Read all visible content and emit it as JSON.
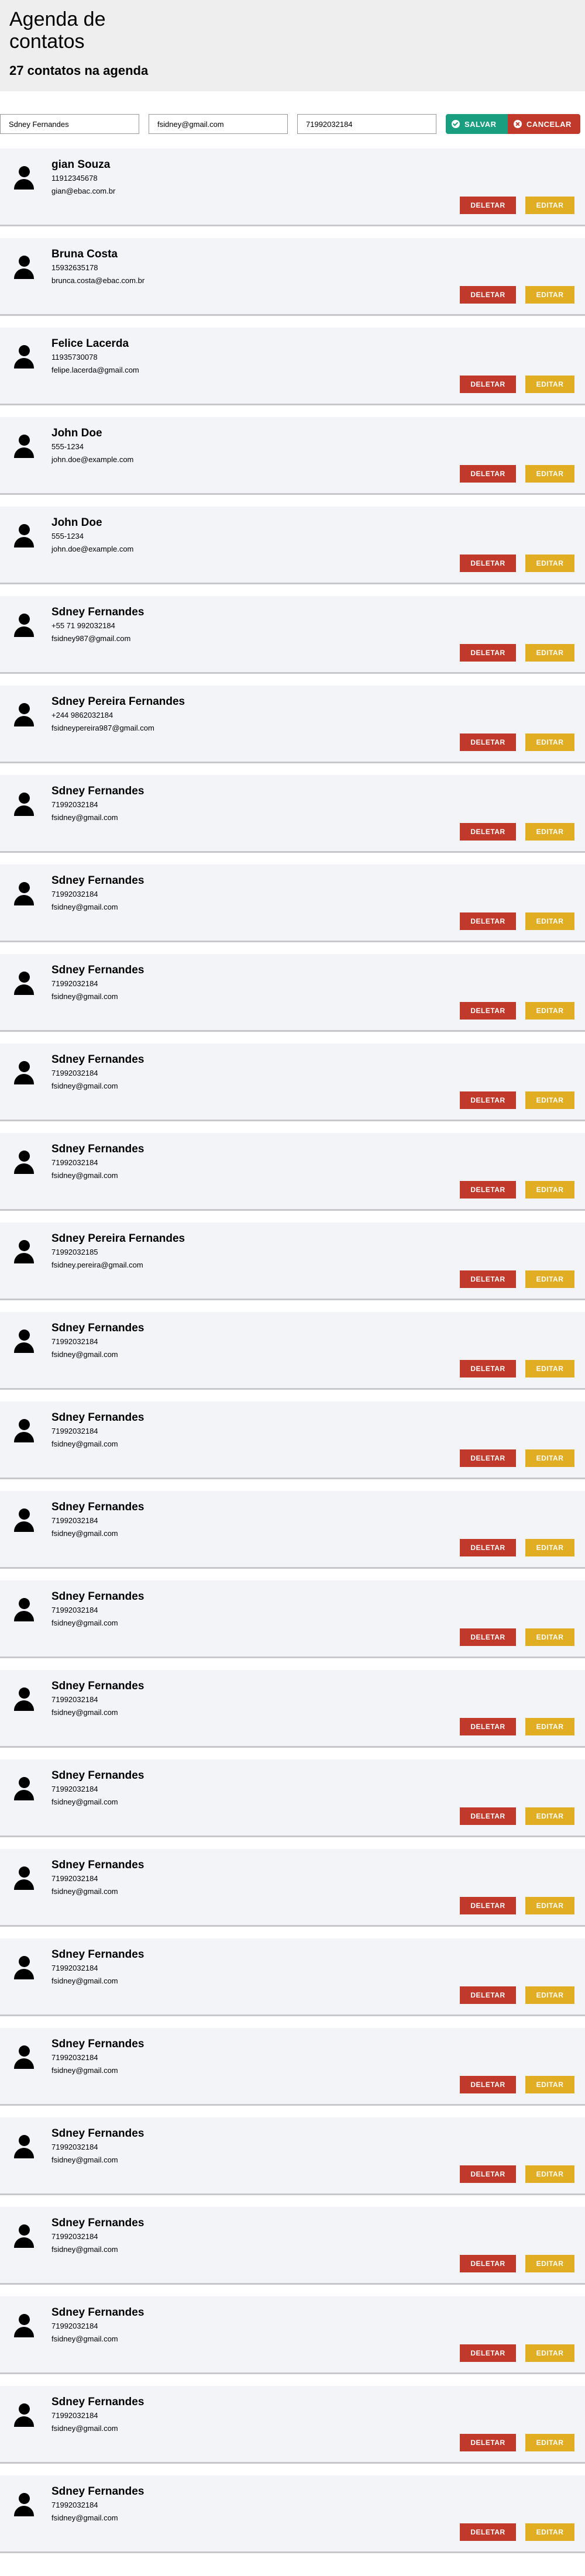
{
  "header": {
    "title": "Agenda de contatos",
    "count_text": "27 contatos na agenda"
  },
  "form": {
    "name_value": "Sdney Fernandes",
    "email_value": "fsidney@gmail.com",
    "phone_value": "71992032184",
    "save_label": "SALVAR",
    "cancel_label": "CANCELAR"
  },
  "actions": {
    "delete_label": "DELETAR",
    "edit_label": "EDITAR"
  },
  "colors": {
    "save": "#1a9e80",
    "cancel": "#c0392b",
    "delete": "#c0392b",
    "edit": "#e1ad22",
    "card_bg": "#f3f4f8"
  },
  "contacts": [
    {
      "name": "gian Souza",
      "phone": "11912345678",
      "email": "gian@ebac.com.br"
    },
    {
      "name": "Bruna Costa",
      "phone": "15932635178",
      "email": "brunca.costa@ebac.com.br"
    },
    {
      "name": "Felice Lacerda",
      "phone": "11935730078",
      "email": "felipe.lacerda@gmail.com"
    },
    {
      "name": "John Doe",
      "phone": "555-1234",
      "email": "john.doe@example.com"
    },
    {
      "name": "John Doe",
      "phone": "555-1234",
      "email": "john.doe@example.com"
    },
    {
      "name": "Sdney Fernandes",
      "phone": "+55 71 992032184",
      "email": "fsidney987@gmail.com"
    },
    {
      "name": "Sdney Pereira Fernandes",
      "phone": "+244 9862032184",
      "email": "fsidneypereira987@gmail.com"
    },
    {
      "name": "Sdney Fernandes",
      "phone": "71992032184",
      "email": "fsidney@gmail.com"
    },
    {
      "name": "Sdney Fernandes",
      "phone": "71992032184",
      "email": "fsidney@gmail.com"
    },
    {
      "name": "Sdney Fernandes",
      "phone": "71992032184",
      "email": "fsidney@gmail.com"
    },
    {
      "name": "Sdney Fernandes",
      "phone": "71992032184",
      "email": "fsidney@gmail.com"
    },
    {
      "name": "Sdney Fernandes",
      "phone": "71992032184",
      "email": "fsidney@gmail.com"
    },
    {
      "name": "Sdney Pereira Fernandes",
      "phone": "71992032185",
      "email": "fsidney.pereira@gmail.com"
    },
    {
      "name": "Sdney Fernandes",
      "phone": "71992032184",
      "email": "fsidney@gmail.com"
    },
    {
      "name": "Sdney Fernandes",
      "phone": "71992032184",
      "email": "fsidney@gmail.com"
    },
    {
      "name": "Sdney Fernandes",
      "phone": "71992032184",
      "email": "fsidney@gmail.com"
    },
    {
      "name": "Sdney Fernandes",
      "phone": "71992032184",
      "email": "fsidney@gmail.com"
    },
    {
      "name": "Sdney Fernandes",
      "phone": "71992032184",
      "email": "fsidney@gmail.com"
    },
    {
      "name": "Sdney Fernandes",
      "phone": "71992032184",
      "email": "fsidney@gmail.com"
    },
    {
      "name": "Sdney Fernandes",
      "phone": "71992032184",
      "email": "fsidney@gmail.com"
    },
    {
      "name": "Sdney Fernandes",
      "phone": "71992032184",
      "email": "fsidney@gmail.com"
    },
    {
      "name": "Sdney Fernandes",
      "phone": "71992032184",
      "email": "fsidney@gmail.com"
    },
    {
      "name": "Sdney Fernandes",
      "phone": "71992032184",
      "email": "fsidney@gmail.com"
    },
    {
      "name": "Sdney Fernandes",
      "phone": "71992032184",
      "email": "fsidney@gmail.com"
    },
    {
      "name": "Sdney Fernandes",
      "phone": "71992032184",
      "email": "fsidney@gmail.com"
    },
    {
      "name": "Sdney Fernandes",
      "phone": "71992032184",
      "email": "fsidney@gmail.com"
    },
    {
      "name": "Sdney Fernandes",
      "phone": "71992032184",
      "email": "fsidney@gmail.com"
    }
  ]
}
